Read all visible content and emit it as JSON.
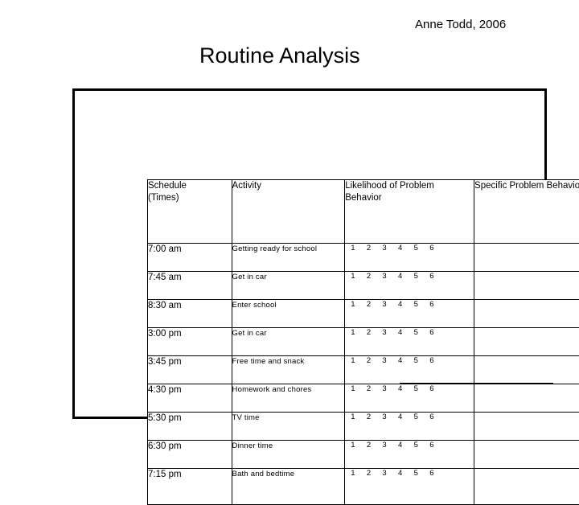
{
  "slide": {
    "title": "Routine Analysis",
    "attribution": "Anne Todd, 2006"
  },
  "table": {
    "columns": [
      {
        "key": "schedule",
        "label_line1": "Schedule",
        "label_line2": "(Times)",
        "align": "center"
      },
      {
        "key": "activity",
        "label_line1": "Activity",
        "label_line2": "",
        "align": "center"
      },
      {
        "key": "likelihood",
        "label_line1": "Likelihood of Problem",
        "label_line2": "Behavior",
        "align": "left"
      },
      {
        "key": "specific",
        "label_line1": "Specific Problem Behavior",
        "label_line2": "",
        "align": "center"
      }
    ],
    "scale": [
      "1",
      "2",
      "3",
      "4",
      "5",
      "6"
    ],
    "rows": [
      {
        "time": "7:00 am",
        "activity": "Getting ready for school",
        "specific": ""
      },
      {
        "time": "7:45 am",
        "activity": "Get in car",
        "specific": ""
      },
      {
        "time": "8:30 am",
        "activity": "Enter school",
        "specific": ""
      },
      {
        "time": "3:00 pm",
        "activity": "Get in car",
        "specific": ""
      },
      {
        "time": "3:45 pm",
        "activity": "Free time and snack",
        "specific": ""
      },
      {
        "time": "4:30 pm",
        "activity": "Homework and chores",
        "specific": ""
      },
      {
        "time": "5:30 pm",
        "activity": "TV time",
        "specific": ""
      },
      {
        "time": "6:30 pm",
        "activity": "Dinner time",
        "specific": ""
      },
      {
        "time": "7:15 pm",
        "activity": "Bath and bedtime",
        "specific": ""
      }
    ]
  },
  "colors": {
    "text": "#000000",
    "background": "#ffffff",
    "border": "#000000"
  }
}
